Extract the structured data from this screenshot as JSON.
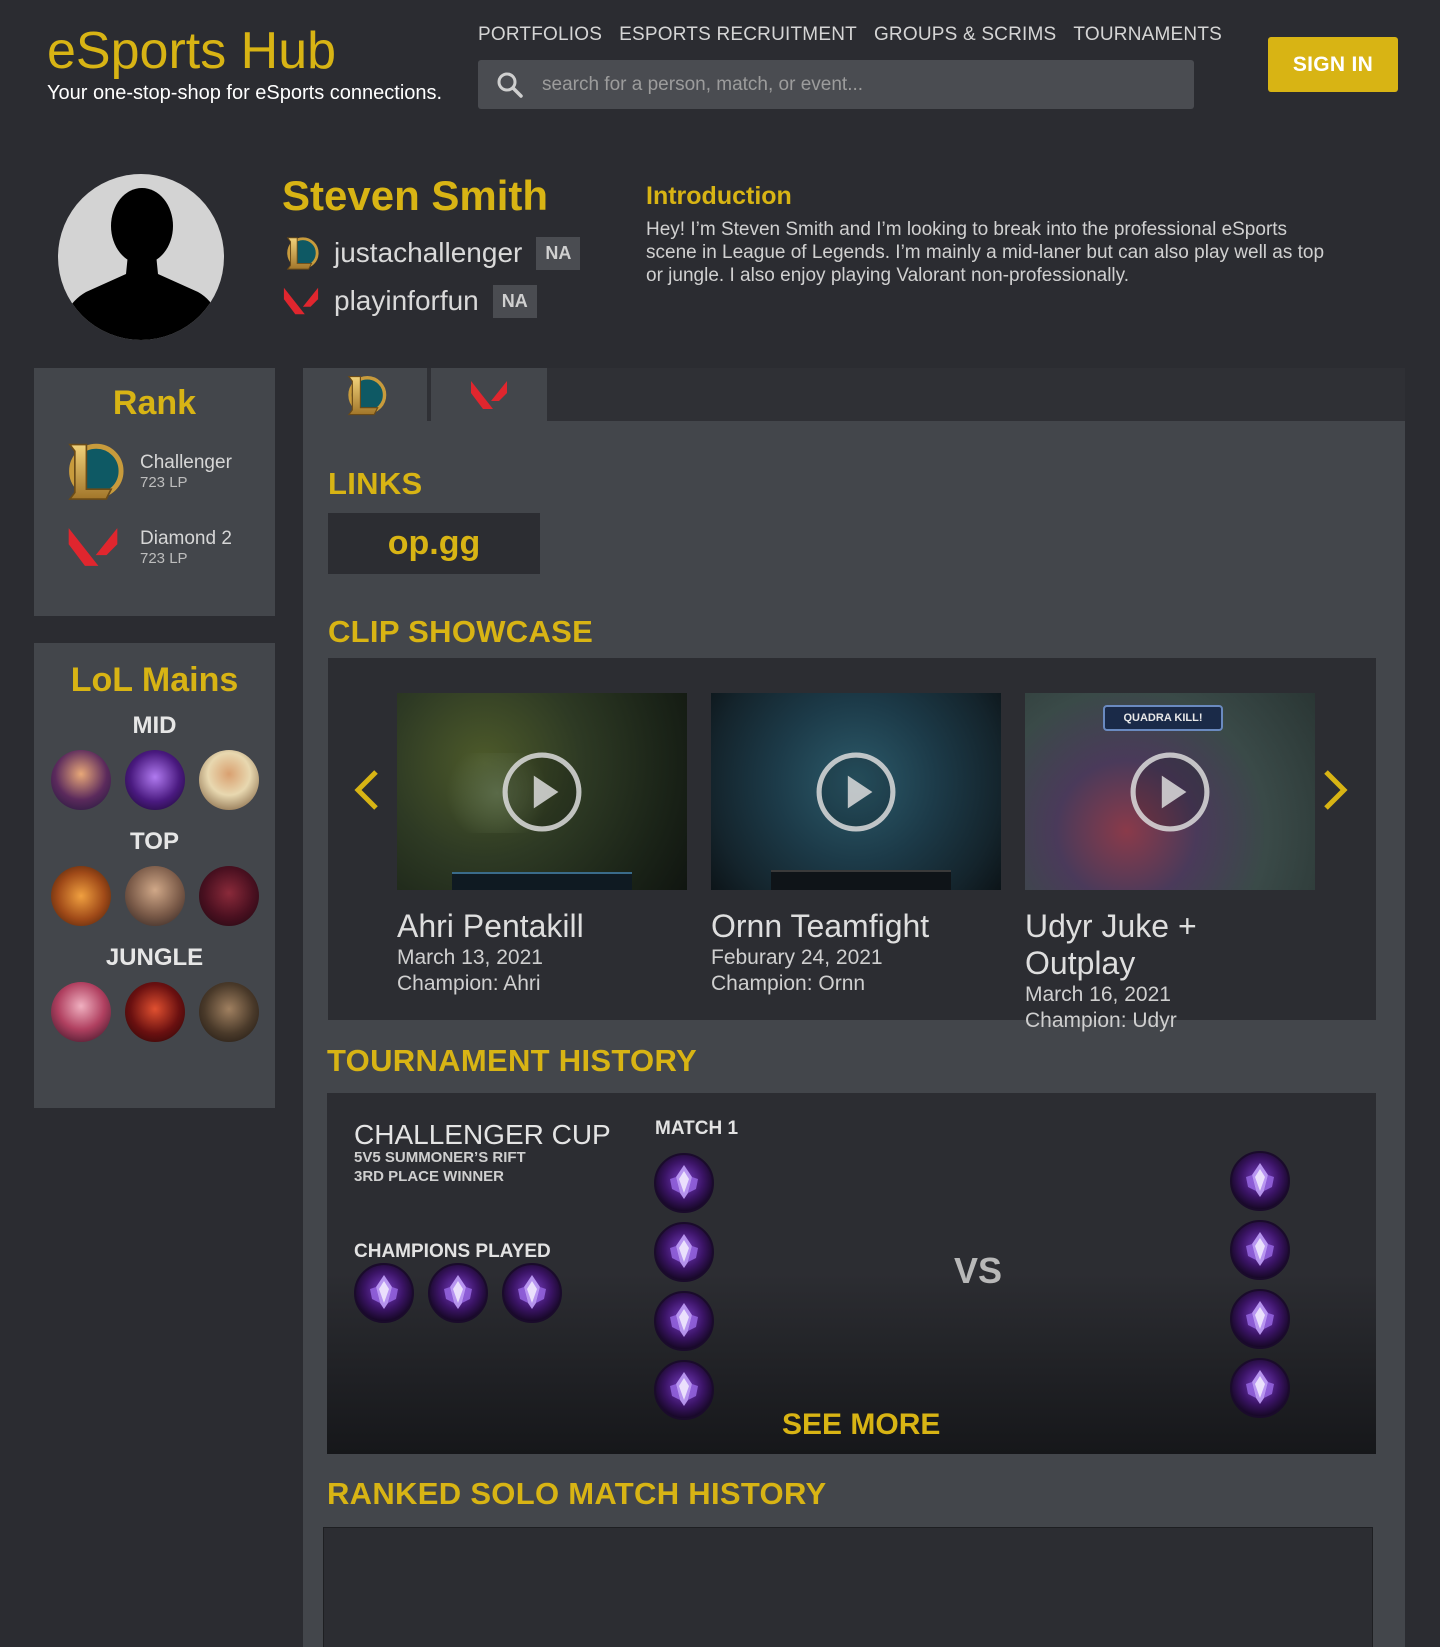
{
  "header": {
    "brand": "eSports Hub",
    "tagline": "Your one-stop-shop for eSports connections.",
    "nav": [
      "PORTFOLIOS",
      "ESPORTS RECRUITMENT",
      "GROUPS & SCRIMS",
      "TOURNAMENTS"
    ],
    "search_placeholder": "search for a person, match, or event...",
    "signin_label": "SIGN IN"
  },
  "profile": {
    "name": "Steven Smith",
    "accounts": [
      {
        "game_icon": "league-icon",
        "username": "justachallenger",
        "region": "NA"
      },
      {
        "game_icon": "valorant-icon",
        "username": "playinforfun",
        "region": "NA"
      }
    ],
    "intro_heading": "Introduction",
    "intro_text": "Hey! I’m Steven Smith and I’m looking to break into the professional eSports scene in League of Legends. I’m mainly a mid-laner but can also play well as top or jungle. I also enjoy playing Valorant non-professionally."
  },
  "rank": {
    "title": "Rank",
    "entries": [
      {
        "icon": "league-icon",
        "tier": "Challenger",
        "lp": "723 LP"
      },
      {
        "icon": "valorant-icon",
        "tier": "Diamond 2",
        "lp": "723 LP"
      }
    ]
  },
  "mains": {
    "title": "LoL Mains",
    "roles": [
      {
        "role": "MID",
        "champs": [
          "champion-portrait-icon",
          "champion-portrait-icon",
          "champion-portrait-icon"
        ]
      },
      {
        "role": "TOP",
        "champs": [
          "champion-portrait-icon",
          "champion-portrait-icon",
          "champion-portrait-icon"
        ]
      },
      {
        "role": "JUNGLE",
        "champs": [
          "champion-portrait-icon",
          "champion-portrait-icon",
          "champion-portrait-icon"
        ]
      }
    ]
  },
  "tabs": [
    {
      "icon": "league-icon",
      "active": true
    },
    {
      "icon": "valorant-icon",
      "active": false
    }
  ],
  "links": {
    "title": "LINKS",
    "items": [
      "op.gg"
    ]
  },
  "clips": {
    "title": "CLIP SHOWCASE",
    "items": [
      {
        "title": "Ahri Pentakill",
        "date": "March 13, 2021",
        "champion": "Champion: Ahri"
      },
      {
        "title": "Ornn Teamfight",
        "date": "Feburary 24, 2021",
        "champion": "Champion: Ornn"
      },
      {
        "title": "Udyr Juke + Outplay",
        "date": "March 16, 2021",
        "champion": "Champion: Udyr",
        "overlay_text": "QUADRA KILL!"
      }
    ]
  },
  "tournaments": {
    "title": "TOURNAMENT HISTORY",
    "entry": {
      "name": "CHALLENGER CUP",
      "mode": "5V5 SUMMONER’S RIFT",
      "result": "3RD PLACE WINNER",
      "champions_label": "CHAMPIONS PLAYED",
      "match_label": "MATCH 1",
      "vs": "VS"
    },
    "see_more": "SEE MORE"
  },
  "ranked": {
    "title": "RANKED SOLO MATCH HISTORY"
  },
  "colors": {
    "accent": "#d8b414",
    "background": "#2b2c31",
    "panel": "#43464b",
    "valorant_red": "#e0262e"
  }
}
